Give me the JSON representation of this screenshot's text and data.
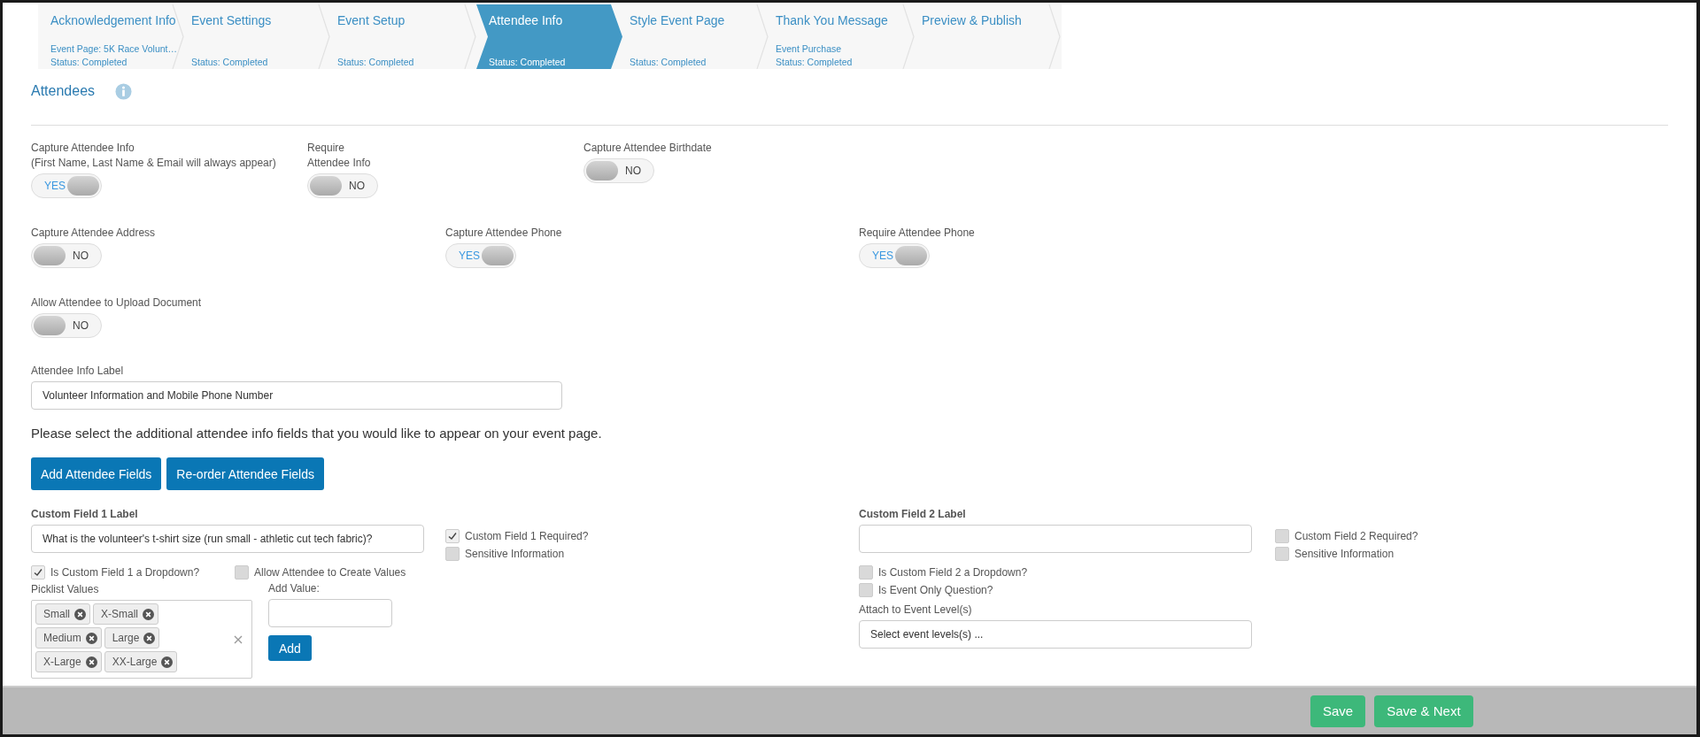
{
  "steps": [
    {
      "title": "Acknowledgement Info",
      "detail": "Event Page: 5K Race Volunt…",
      "status": "Status: Completed",
      "selected": false
    },
    {
      "title": "Event Settings",
      "status": "Status: Completed",
      "selected": false
    },
    {
      "title": "Event Setup",
      "status": "Status: Completed",
      "selected": false
    },
    {
      "title": "Attendee Info",
      "status": "Status: Completed",
      "selected": true
    },
    {
      "title": "Style Event Page",
      "status": "Status: Completed",
      "selected": false
    },
    {
      "title": "Thank You Message",
      "detail": "Event Purchase",
      "status": "Status: Completed",
      "selected": false
    },
    {
      "title": "Preview & Publish",
      "selected": false
    }
  ],
  "section_title": "Attendees",
  "toggle_rows": [
    [
      {
        "label_lines": [
          "Capture Attendee Info",
          "(First Name, Last Name & Email will always appear)"
        ],
        "on": true,
        "text": "YES"
      },
      {
        "label_lines": [
          "Require",
          "Attendee Info"
        ],
        "on": false,
        "text": "NO"
      },
      {
        "label_lines": [
          "Capture Attendee Birthdate"
        ],
        "on": false,
        "text": "NO"
      }
    ],
    [
      {
        "label_lines": [
          "Capture Attendee Address"
        ],
        "on": false,
        "text": "NO"
      },
      {
        "label_lines": [
          "Capture Attendee Phone"
        ],
        "on": true,
        "text": "YES"
      },
      {
        "label_lines": [
          "Require Attendee Phone"
        ],
        "on": true,
        "text": "YES"
      }
    ],
    [
      {
        "label_lines": [
          "Allow Attendee to Upload Document"
        ],
        "on": false,
        "text": "NO"
      }
    ]
  ],
  "info_label": {
    "label": "Attendee Info Label",
    "value": "Volunteer Information and Mobile Phone Number"
  },
  "prompt": "Please select the additional attendee info fields that you would like to appear on your event page.",
  "field_buttons": [
    "Add Attendee Fields",
    "Re-order Attendee Fields"
  ],
  "custom_field_1": {
    "label": "Custom Field 1 Label",
    "value": "What is the volunteer's t-shirt size (run small - athletic cut tech fabric)?",
    "side_checks": [
      {
        "label": "Custom Field 1 Required?",
        "checked": true
      },
      {
        "label": "Sensitive Information",
        "checked": false
      }
    ],
    "dropdown": {
      "label": "Is Custom Field 1 a Dropdown?",
      "checked": true
    },
    "allow_create": {
      "label": "Allow Attendee to Create Values",
      "checked": false
    },
    "picklist_label": "Picklist Values",
    "picklist_values": [
      [
        "Small",
        "X-Small"
      ],
      [
        "Medium",
        "Large"
      ],
      [
        "X-Large",
        "XX-Large"
      ]
    ],
    "add_value_label": "Add Value:",
    "add_button": "Add"
  },
  "custom_field_2": {
    "label": "Custom Field 2 Label",
    "side_checks": [
      {
        "label": "Custom Field 2 Required?",
        "checked": false
      },
      {
        "label": "Sensitive Information",
        "checked": false
      }
    ],
    "checks": [
      {
        "label": "Is Custom Field 2 a Dropdown?",
        "checked": false
      },
      {
        "label": "Is Event Only Question?",
        "checked": false
      }
    ],
    "attach_label": "Attach to Event Level(s)",
    "attach_placeholder": "Select event levels(s) ..."
  },
  "footer_buttons": [
    "Save",
    "Save & Next"
  ]
}
